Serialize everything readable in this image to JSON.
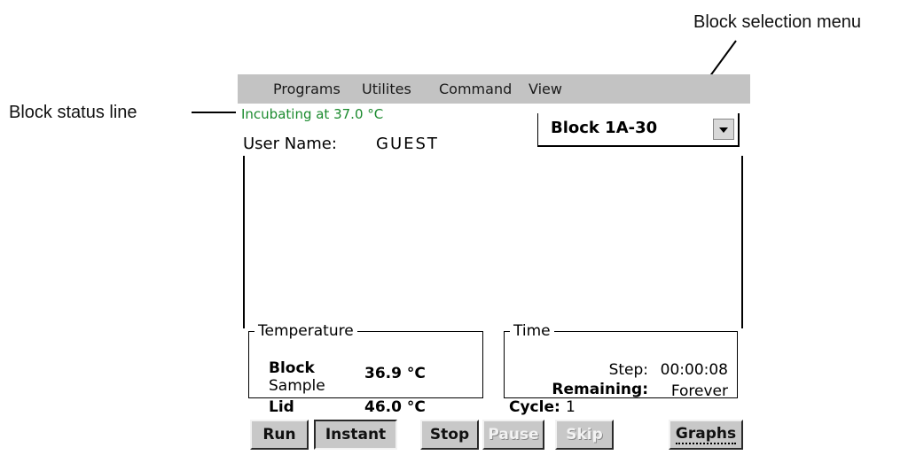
{
  "callouts": {
    "status_line": "Block status line",
    "block_menu": "Block selection menu"
  },
  "menu": [
    "Programs",
    "Utilites",
    "Command",
    "View"
  ],
  "status_line": "Incubating at 37.0 °C",
  "user": {
    "label": "User Name:",
    "value": "GUEST"
  },
  "block_select": {
    "value": "Block 1A-30"
  },
  "temperature": {
    "title": "Temperature",
    "block_label": "Block",
    "block_value": "36.9 °C",
    "sample_label": "Sample",
    "lid_label": "Lid",
    "lid_value": "46.0 °C"
  },
  "time": {
    "title": "Time",
    "step_label": "Step:",
    "step_value": "00:00:08",
    "remaining_label": "Remaining:",
    "remaining_value": "Forever"
  },
  "cycle": {
    "label": "Cycle:",
    "value": "1"
  },
  "buttons": [
    {
      "label": "Run",
      "enabled": true
    },
    {
      "label": "Instant",
      "enabled": true
    },
    {
      "label": "Stop",
      "enabled": true
    },
    {
      "label": "Pause",
      "enabled": false
    },
    {
      "label": "Skip",
      "enabled": false
    },
    {
      "label": "Graphs",
      "enabled": true
    }
  ]
}
